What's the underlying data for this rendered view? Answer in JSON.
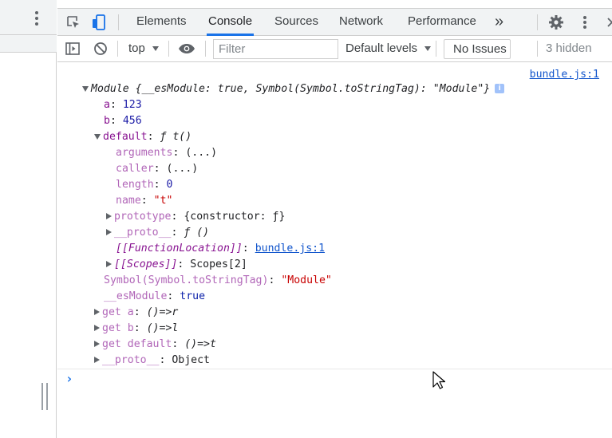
{
  "devtools": {
    "tabs": [
      "Elements",
      "Console",
      "Sources",
      "Network",
      "Performance"
    ],
    "active_tab": "Console",
    "more_tabs_glyph": "»"
  },
  "toolbar": {
    "context": "top",
    "filter_placeholder": "Filter",
    "levels": "Default levels",
    "issues": "No Issues",
    "hidden": "3 hidden"
  },
  "console": {
    "source": "bundle.js:1",
    "module_label": "Module",
    "module_preview": "{__esModule: true, Symbol(Symbol.toStringTag): \"Module\"}",
    "info_glyph": "i",
    "lines": {
      "a_key": "a",
      "a_val": "123",
      "b_key": "b",
      "b_val": "456",
      "default_key": "default",
      "default_val": "ƒ t()",
      "arguments_key": "arguments",
      "arguments_val": "(...)",
      "caller_key": "caller",
      "caller_val": "(...)",
      "length_key": "length",
      "length_val": "0",
      "name_key": "name",
      "name_val": "\"t\"",
      "prototype_key": "prototype",
      "prototype_val": "{constructor: ƒ}",
      "proto_key": "__proto__",
      "proto_val": "ƒ ()",
      "fnloc_key": "[[FunctionLocation]]",
      "fnloc_val": "bundle.js:1",
      "scopes_key": "[[Scopes]]",
      "scopes_val": "Scopes[2]",
      "tostring_key": "Symbol(Symbol.toStringTag)",
      "tostring_val": "\"Module\"",
      "esmodule_key": "__esModule",
      "esmodule_val": "true",
      "get_a_key": "get a",
      "get_a_val": "()=>r",
      "get_b_key": "get b",
      "get_b_val": "()=>l",
      "get_default_key": "get default",
      "get_default_val": "()=>t",
      "proto2_key": "__proto__",
      "proto2_val": "Object"
    },
    "prompt_glyph": "›"
  }
}
